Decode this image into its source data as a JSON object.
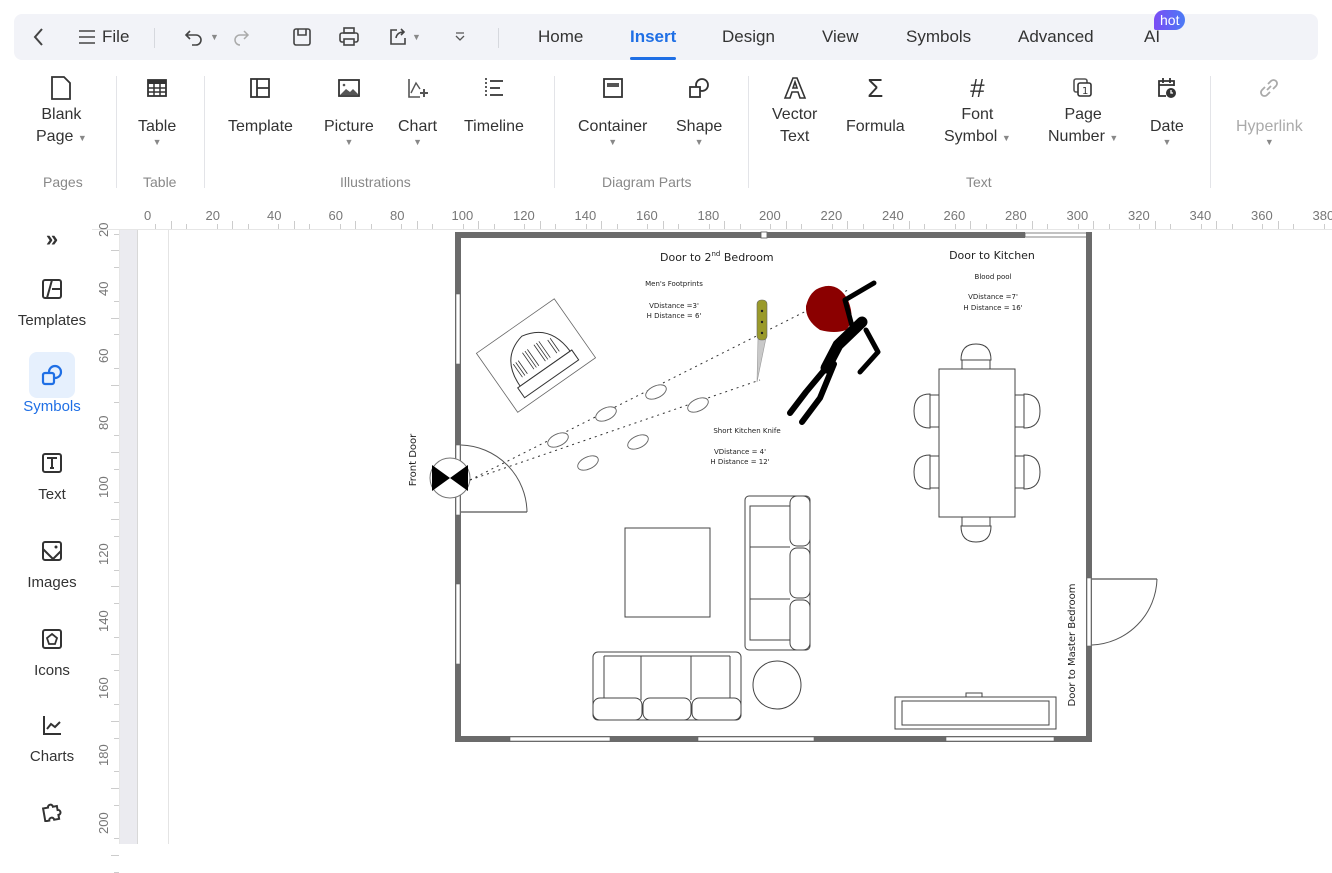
{
  "menubar": {
    "back_icon": "chevron-left-icon",
    "file_label": "File",
    "tabs": [
      {
        "label": "Home",
        "active": false
      },
      {
        "label": "Insert",
        "active": true
      },
      {
        "label": "Design",
        "active": false
      },
      {
        "label": "View",
        "active": false
      },
      {
        "label": "Symbols",
        "active": false
      },
      {
        "label": "Advanced",
        "active": false
      },
      {
        "label": "AI",
        "active": false
      }
    ],
    "ai_badge": "hot"
  },
  "ribbon": {
    "buttons": {
      "blank_page": {
        "line1": "Blank",
        "line2": "Page"
      },
      "table": "Table",
      "template": "Template",
      "picture": "Picture",
      "chart": "Chart",
      "timeline": "Timeline",
      "container": "Container",
      "shape": "Shape",
      "vector_text": {
        "line1": "Vector",
        "line2": "Text"
      },
      "formula": "Formula",
      "font_symbol": {
        "line1": "Font",
        "line2": "Symbol"
      },
      "page_number": {
        "line1": "Page",
        "line2": "Number"
      },
      "date": "Date",
      "hyperlink": "Hyperlink"
    },
    "groups": {
      "pages": "Pages",
      "table": "Table",
      "illustrations": "Illustrations",
      "diagram_parts": "Diagram Parts",
      "text": "Text"
    }
  },
  "sidebar": {
    "expand_icon": "double-chevron-right-icon",
    "items": [
      {
        "label": "Templates",
        "active": false
      },
      {
        "label": "Symbols",
        "active": true
      },
      {
        "label": "Text",
        "active": false
      },
      {
        "label": "Images",
        "active": false
      },
      {
        "label": "Icons",
        "active": false
      },
      {
        "label": "Charts",
        "active": false
      }
    ]
  },
  "rulers": {
    "top": [
      "0",
      "20",
      "40",
      "60",
      "80",
      "100",
      "120",
      "140",
      "160",
      "180",
      "200",
      "220",
      "240",
      "260",
      "280",
      "300",
      "320",
      "340",
      "360",
      "380"
    ],
    "left": [
      "20",
      "40",
      "60",
      "80",
      "100",
      "120",
      "140",
      "160",
      "180",
      "200"
    ]
  },
  "floorplan": {
    "door_2nd_bedroom": "Door to 2",
    "door_2nd_bedroom_sup": "nd",
    "door_2nd_bedroom_suffix": " Bedroom",
    "door_kitchen": "Door to Kitchen",
    "front_door": "Front Door",
    "door_master": "Door to Master Bedroom",
    "footprints": {
      "title": "Men's Footprints",
      "v": "VDistance =3'",
      "h": "H Distance = 6'"
    },
    "blood_pool": {
      "title": "Blood pool",
      "v": "VDistance =7'",
      "h": "H Distance = 16'"
    },
    "knife": {
      "title": "Short Kitchen Knife",
      "v": "VDistance = 4'",
      "h": "H Distance = 12'"
    },
    "colors": {
      "wall": "#6b6b6b",
      "blood": "#8b0000",
      "knife_handle": "#9a9a2a",
      "body": "#000000"
    }
  },
  "colors": {
    "accent": "#1f6fe5",
    "menubar_bg": "#f2f3f8",
    "hot_badge": "#6a5af5"
  }
}
